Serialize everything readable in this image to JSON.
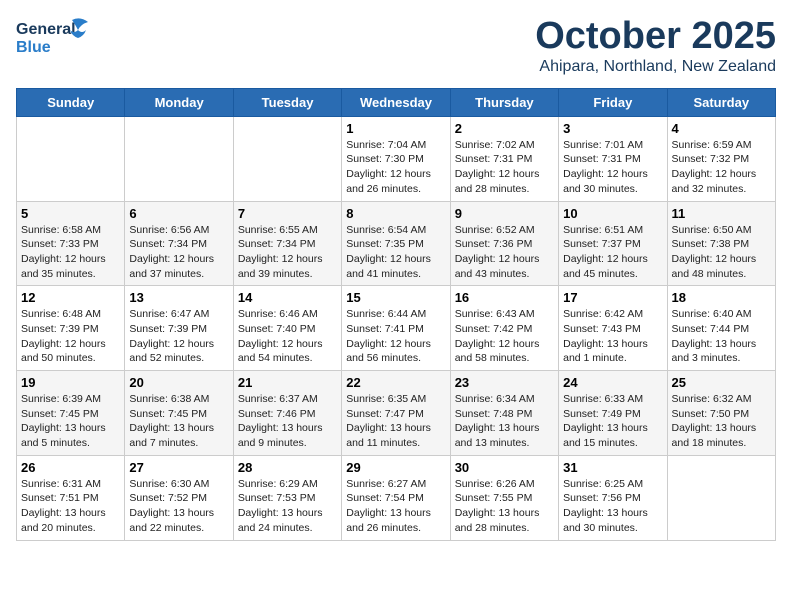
{
  "header": {
    "logo_line1": "General",
    "logo_line2": "Blue",
    "month": "October 2025",
    "location": "Ahipara, Northland, New Zealand"
  },
  "days_of_week": [
    "Sunday",
    "Monday",
    "Tuesday",
    "Wednesday",
    "Thursday",
    "Friday",
    "Saturday"
  ],
  "weeks": [
    [
      {
        "day": "",
        "info": ""
      },
      {
        "day": "",
        "info": ""
      },
      {
        "day": "",
        "info": ""
      },
      {
        "day": "1",
        "info": "Sunrise: 7:04 AM\nSunset: 7:30 PM\nDaylight: 12 hours\nand 26 minutes."
      },
      {
        "day": "2",
        "info": "Sunrise: 7:02 AM\nSunset: 7:31 PM\nDaylight: 12 hours\nand 28 minutes."
      },
      {
        "day": "3",
        "info": "Sunrise: 7:01 AM\nSunset: 7:31 PM\nDaylight: 12 hours\nand 30 minutes."
      },
      {
        "day": "4",
        "info": "Sunrise: 6:59 AM\nSunset: 7:32 PM\nDaylight: 12 hours\nand 32 minutes."
      }
    ],
    [
      {
        "day": "5",
        "info": "Sunrise: 6:58 AM\nSunset: 7:33 PM\nDaylight: 12 hours\nand 35 minutes."
      },
      {
        "day": "6",
        "info": "Sunrise: 6:56 AM\nSunset: 7:34 PM\nDaylight: 12 hours\nand 37 minutes."
      },
      {
        "day": "7",
        "info": "Sunrise: 6:55 AM\nSunset: 7:34 PM\nDaylight: 12 hours\nand 39 minutes."
      },
      {
        "day": "8",
        "info": "Sunrise: 6:54 AM\nSunset: 7:35 PM\nDaylight: 12 hours\nand 41 minutes."
      },
      {
        "day": "9",
        "info": "Sunrise: 6:52 AM\nSunset: 7:36 PM\nDaylight: 12 hours\nand 43 minutes."
      },
      {
        "day": "10",
        "info": "Sunrise: 6:51 AM\nSunset: 7:37 PM\nDaylight: 12 hours\nand 45 minutes."
      },
      {
        "day": "11",
        "info": "Sunrise: 6:50 AM\nSunset: 7:38 PM\nDaylight: 12 hours\nand 48 minutes."
      }
    ],
    [
      {
        "day": "12",
        "info": "Sunrise: 6:48 AM\nSunset: 7:39 PM\nDaylight: 12 hours\nand 50 minutes."
      },
      {
        "day": "13",
        "info": "Sunrise: 6:47 AM\nSunset: 7:39 PM\nDaylight: 12 hours\nand 52 minutes."
      },
      {
        "day": "14",
        "info": "Sunrise: 6:46 AM\nSunset: 7:40 PM\nDaylight: 12 hours\nand 54 minutes."
      },
      {
        "day": "15",
        "info": "Sunrise: 6:44 AM\nSunset: 7:41 PM\nDaylight: 12 hours\nand 56 minutes."
      },
      {
        "day": "16",
        "info": "Sunrise: 6:43 AM\nSunset: 7:42 PM\nDaylight: 12 hours\nand 58 minutes."
      },
      {
        "day": "17",
        "info": "Sunrise: 6:42 AM\nSunset: 7:43 PM\nDaylight: 13 hours\nand 1 minute."
      },
      {
        "day": "18",
        "info": "Sunrise: 6:40 AM\nSunset: 7:44 PM\nDaylight: 13 hours\nand 3 minutes."
      }
    ],
    [
      {
        "day": "19",
        "info": "Sunrise: 6:39 AM\nSunset: 7:45 PM\nDaylight: 13 hours\nand 5 minutes."
      },
      {
        "day": "20",
        "info": "Sunrise: 6:38 AM\nSunset: 7:45 PM\nDaylight: 13 hours\nand 7 minutes."
      },
      {
        "day": "21",
        "info": "Sunrise: 6:37 AM\nSunset: 7:46 PM\nDaylight: 13 hours\nand 9 minutes."
      },
      {
        "day": "22",
        "info": "Sunrise: 6:35 AM\nSunset: 7:47 PM\nDaylight: 13 hours\nand 11 minutes."
      },
      {
        "day": "23",
        "info": "Sunrise: 6:34 AM\nSunset: 7:48 PM\nDaylight: 13 hours\nand 13 minutes."
      },
      {
        "day": "24",
        "info": "Sunrise: 6:33 AM\nSunset: 7:49 PM\nDaylight: 13 hours\nand 15 minutes."
      },
      {
        "day": "25",
        "info": "Sunrise: 6:32 AM\nSunset: 7:50 PM\nDaylight: 13 hours\nand 18 minutes."
      }
    ],
    [
      {
        "day": "26",
        "info": "Sunrise: 6:31 AM\nSunset: 7:51 PM\nDaylight: 13 hours\nand 20 minutes."
      },
      {
        "day": "27",
        "info": "Sunrise: 6:30 AM\nSunset: 7:52 PM\nDaylight: 13 hours\nand 22 minutes."
      },
      {
        "day": "28",
        "info": "Sunrise: 6:29 AM\nSunset: 7:53 PM\nDaylight: 13 hours\nand 24 minutes."
      },
      {
        "day": "29",
        "info": "Sunrise: 6:27 AM\nSunset: 7:54 PM\nDaylight: 13 hours\nand 26 minutes."
      },
      {
        "day": "30",
        "info": "Sunrise: 6:26 AM\nSunset: 7:55 PM\nDaylight: 13 hours\nand 28 minutes."
      },
      {
        "day": "31",
        "info": "Sunrise: 6:25 AM\nSunset: 7:56 PM\nDaylight: 13 hours\nand 30 minutes."
      },
      {
        "day": "",
        "info": ""
      }
    ]
  ]
}
